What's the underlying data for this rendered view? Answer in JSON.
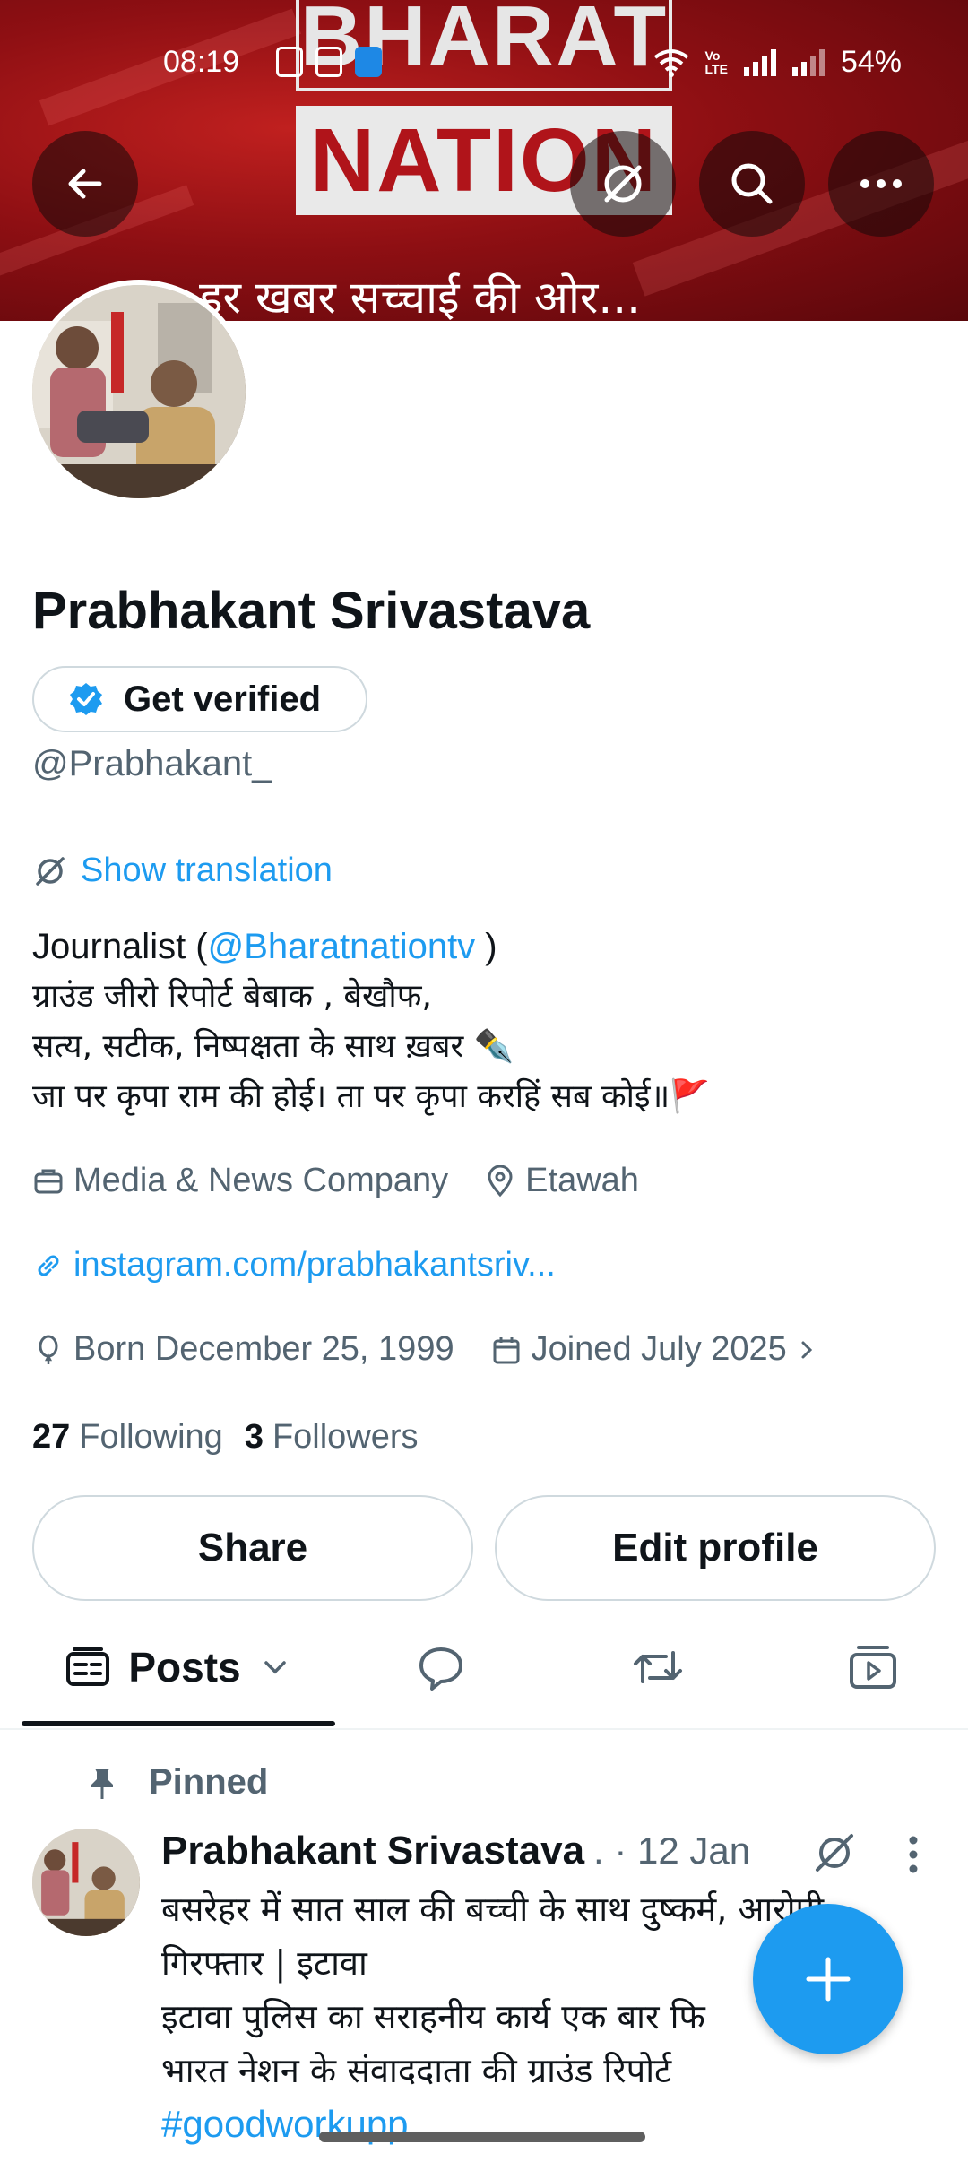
{
  "status_bar": {
    "time": "08:19",
    "battery": "54%"
  },
  "banner": {
    "logo_top": "BHARAT",
    "logo_bottom": "NATION",
    "tagline": "हर खबर सच्चाई की ओर..."
  },
  "profile": {
    "name": "Prabhakant Srivastava",
    "verify_label": "Get verified",
    "handle": "@Prabhakant_",
    "translate_label": "Show translation",
    "bio": {
      "line1_prefix": "Journalist (",
      "line1_link": "@Bharatnationtv",
      "line1_suffix": " )",
      "line2": "ग्राउंड जीरो रिपोर्ट बेबाक , बेखौफ,",
      "line3": "सत्य, सटीक, निष्पक्षता के साथ ख़बर ✒️",
      "line4": "जा पर कृपा राम की होई। ता पर कृपा करहिं सब कोई॥🚩"
    },
    "category": "Media & News Company",
    "location": "Etawah",
    "website": "instagram.com/prabhakantsriv...",
    "born": "Born December 25, 1999",
    "joined": "Joined July 2025",
    "following_count": "27",
    "following_label": "Following",
    "followers_count": "3",
    "followers_label": "Followers",
    "share_label": "Share",
    "edit_label": "Edit profile"
  },
  "tabs": {
    "posts_label": "Posts"
  },
  "post": {
    "pinned_label": "Pinned",
    "author": "Prabhakant Srivastava",
    "date": ". · 12 Jan",
    "line1": "बसरेहर में सात साल की बच्ची के साथ दुष्कर्म, आरोपी",
    "line2": "गिरफ्तार | इटावा",
    "line3": "इटावा पुलिस का सराहनीय कार्य एक बार फि",
    "line4": "भारत नेशन के संवाददाता की ग्राउंड रिपोर्ट",
    "hashtag": "#goodworkupp"
  },
  "colors": {
    "accent": "#1d9bf0",
    "text_primary": "#0f1419",
    "text_secondary": "#536471",
    "banner_red": "#8e0f13"
  }
}
